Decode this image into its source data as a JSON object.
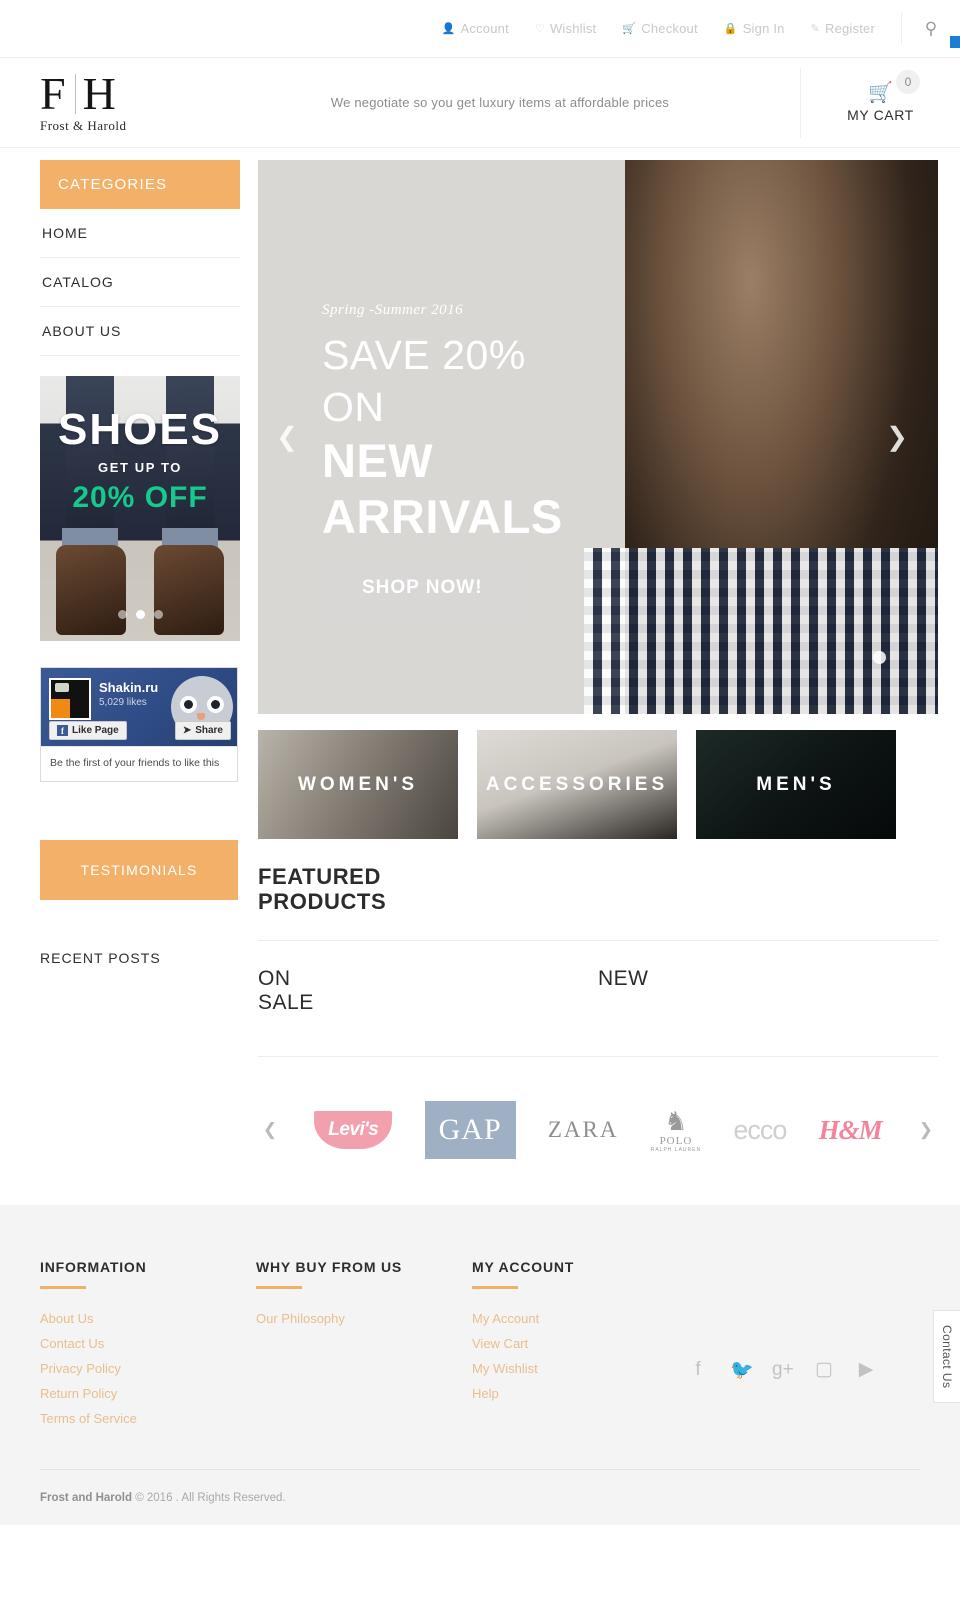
{
  "topbar": {
    "links": [
      {
        "label": "Account",
        "icon": "user-icon"
      },
      {
        "label": "Wishlist",
        "icon": "heart-icon"
      },
      {
        "label": "Checkout",
        "icon": "cart-icon"
      },
      {
        "label": "Sign In",
        "icon": "lock-icon"
      },
      {
        "label": "Register",
        "icon": "pencil-icon"
      }
    ],
    "search_icon": "search-icon"
  },
  "header": {
    "logo_left": "F",
    "logo_right": "H",
    "logo_sub": "Frost & Harold",
    "tagline": "We negotiate so you get luxury items at affordable prices",
    "cart_count": "0",
    "cart_label": "MY CART"
  },
  "sidebar": {
    "categories_title": "CATEGORIES",
    "items": [
      {
        "label": "HOME"
      },
      {
        "label": "CATALOG"
      },
      {
        "label": "ABOUT US"
      }
    ],
    "shoes_banner": {
      "title": "SHOES",
      "subtitle": "GET UP TO",
      "offer": "20% OFF",
      "offer_color": "#16c98d",
      "dots": 3,
      "active_dot": 1
    },
    "facebook": {
      "page_name": "Shakin.ru",
      "likes": "5,029 likes",
      "like_button": "Like Page",
      "share_button": "Share",
      "footer_text": "Be the first of your friends to like this"
    },
    "testimonials_title": "TESTIMONIALS",
    "recent_posts_title": "RECENT POSTS"
  },
  "hero": {
    "season": "Spring -Summer 2016",
    "line1": "SAVE 20%",
    "line2": "ON",
    "line3": "NEW",
    "line4": "ARRIVALS",
    "button": "SHOP NOW!",
    "prev_icon": "chevron-left-icon",
    "next_icon": "chevron-right-icon"
  },
  "tiles": [
    {
      "label": "WOMEN'S"
    },
    {
      "label": "ACCESSORIES"
    },
    {
      "label": "MEN'S"
    }
  ],
  "sections": {
    "featured_line1": "FEATURED",
    "featured_line2": "PRODUCTS",
    "on_sale_line1": "ON",
    "on_sale_line2": "SALE",
    "new_title": "NEW"
  },
  "brands": {
    "prev_icon": "chevron-left-icon",
    "next_icon": "chevron-right-icon",
    "items": [
      {
        "name": "Levi's",
        "color": "#f3a0ae"
      },
      {
        "name": "GAP",
        "color": "#9fb0c4"
      },
      {
        "name": "ZARA",
        "color": "#8e8e8e"
      },
      {
        "name": "POLO",
        "sub": "RALPH LAUREN",
        "color": "#9a9a9a"
      },
      {
        "name": "ecco",
        "color": "#cfcfcf"
      },
      {
        "name": "H&M",
        "color": "#f3849b"
      }
    ]
  },
  "footer": {
    "accent_color": "#f0b069",
    "columns": [
      {
        "title": "INFORMATION",
        "links": [
          "About Us",
          "Contact Us",
          "Privacy Policy",
          "Return Policy",
          "Terms of Service"
        ]
      },
      {
        "title": "WHY BUY FROM US",
        "links": [
          "Our Philosophy"
        ]
      },
      {
        "title": "MY ACCOUNT",
        "links": [
          "My Account",
          "View Cart",
          "My Wishlist",
          "Help"
        ]
      }
    ],
    "socials": [
      "facebook-icon",
      "twitter-icon",
      "google-plus-icon",
      "instagram-icon",
      "youtube-icon"
    ],
    "copyright_brand": "Frost and Harold",
    "copyright_rest": " © 2016 . All Rights Reserved."
  },
  "contact_tab": "Contact Us"
}
